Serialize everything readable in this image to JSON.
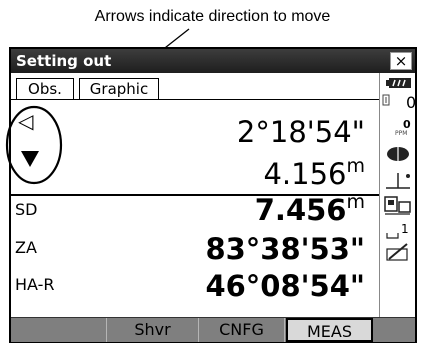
{
  "callout": "Arrows indicate direction to move",
  "window": {
    "title": "Setting out",
    "close_label": "×"
  },
  "tabs": [
    {
      "label": "Obs."
    },
    {
      "label": "Graphic"
    }
  ],
  "direction": {
    "horizontal_arrow": "◁"
  },
  "values": {
    "angle": "2°18'54\"",
    "distance": "4.156",
    "distance_unit": "m"
  },
  "rows": [
    {
      "label": "SD",
      "value": "7.456",
      "unit": "m"
    },
    {
      "label": "ZA",
      "value": "83°38'53\""
    },
    {
      "label": "HA-R",
      "value": "46°08'54\""
    }
  ],
  "sidebar": {
    "icons": [
      "battery-icon",
      "prism-icon",
      "ppm-icon",
      "target-icon",
      "tilt-icon",
      "mode-icon",
      "page-icon",
      "edit-icon"
    ],
    "prism_constant": "0",
    "ppm_value": "0",
    "ppm_label": "PPM",
    "page_number": "1"
  },
  "softkeys": [
    {
      "label": ""
    },
    {
      "label": "Shvr"
    },
    {
      "label": "CNFG"
    },
    {
      "label": "MEAS"
    },
    {
      "label": ""
    }
  ]
}
